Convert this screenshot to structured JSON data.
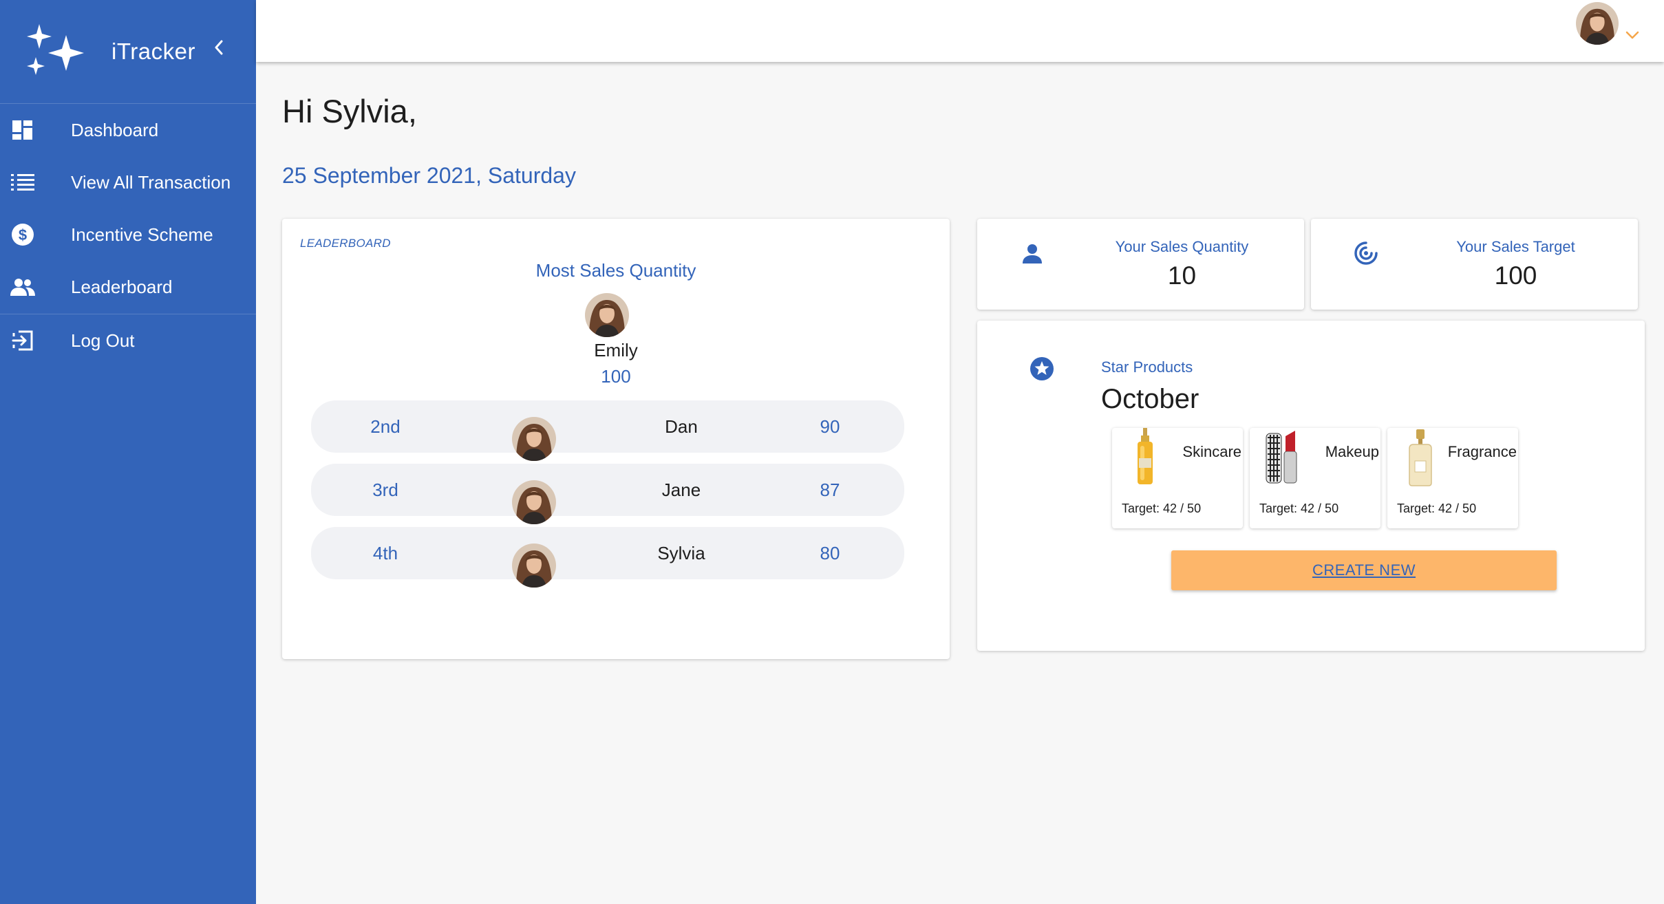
{
  "brand": {
    "name": "iTracker",
    "logo_icon": "sparkles-icon"
  },
  "sidebar": {
    "collapse_icon": "chevron-left-icon",
    "items": [
      {
        "label": "Dashboard",
        "icon": "dashboard-icon"
      },
      {
        "label": "View All Transaction",
        "icon": "list-icon"
      },
      {
        "label": "Incentive Scheme",
        "icon": "dollar-circle-icon"
      },
      {
        "label": "Leaderboard",
        "icon": "people-icon"
      }
    ],
    "logout": {
      "label": "Log Out",
      "icon": "logout-icon"
    }
  },
  "topbar": {
    "menu_icon": "chevron-down-icon"
  },
  "greeting": "Hi Sylvia,",
  "date": "25 September 2021, Saturday",
  "leaderboard": {
    "caption": "LEADERBOARD",
    "title": "Most Sales Quantity",
    "top": {
      "name": "Emily",
      "score": "100"
    },
    "rows": [
      {
        "rank": "2nd",
        "name": "Dan",
        "score": "90"
      },
      {
        "rank": "3rd",
        "name": "Jane",
        "score": "87"
      },
      {
        "rank": "4th",
        "name": "Sylvia",
        "score": "80"
      }
    ]
  },
  "stats": {
    "quantity": {
      "label": "Your Sales Quantity",
      "value": "10",
      "icon": "person-icon"
    },
    "target": {
      "label": "Your Sales Target",
      "value": "100",
      "icon": "target-icon"
    }
  },
  "star_products": {
    "caption": "Star Products",
    "month": "October",
    "icon": "star-circle-icon",
    "items": [
      {
        "name": "Skincare",
        "target": "Target: 42 / 50"
      },
      {
        "name": "Makeup",
        "target": "Target: 42 / 50"
      },
      {
        "name": "Fragrance",
        "target": "Target: 42 / 50"
      }
    ],
    "create_label": "CREATE NEW"
  },
  "colors": {
    "primary": "#3364b9",
    "accent": "#fdb66a",
    "background": "#f7f7f7"
  }
}
